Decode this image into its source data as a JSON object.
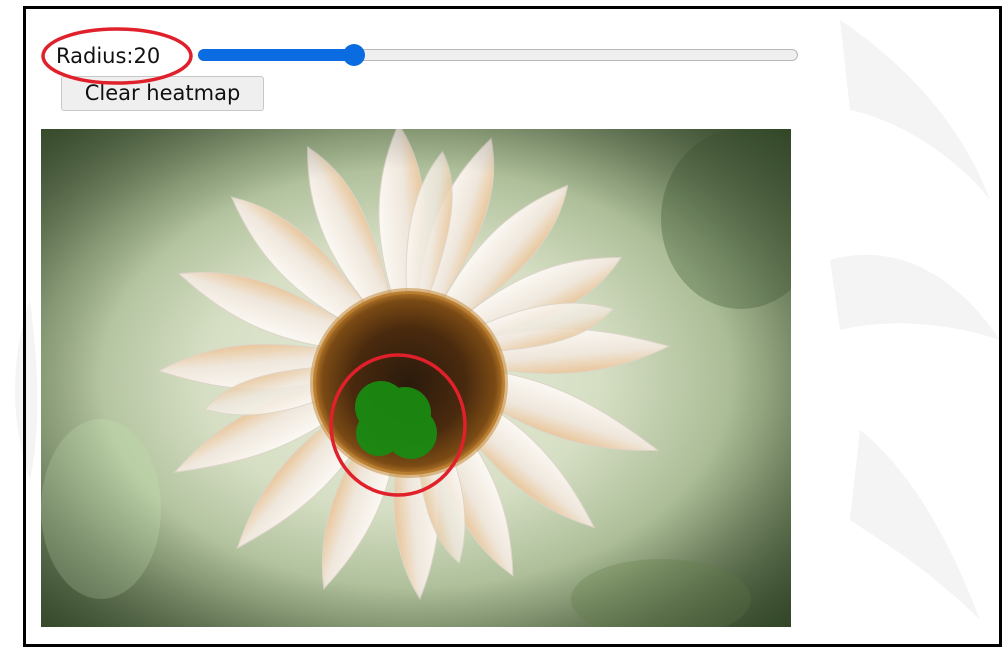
{
  "controls": {
    "radius_label": "Radius:20",
    "radius_value": 20,
    "radius_slider_fraction": 0.26,
    "clear_button_label": "Clear heatmap"
  },
  "photo": {
    "subject": "white daisy flower",
    "heatmap_color": "#1a8a12"
  },
  "annotations": {
    "color": "#e0202a"
  },
  "colors": {
    "slider_accent": "#0a6ce0",
    "frame_border": "#000000"
  }
}
